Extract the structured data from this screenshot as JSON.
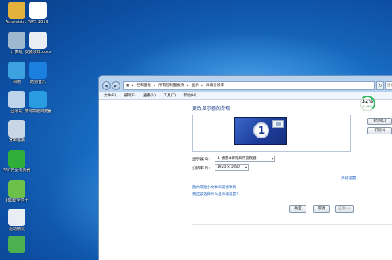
{
  "desktop": {
    "icons": [
      {
        "label": "Administr...",
        "icon": "user-folder-icon",
        "color": "#e3b23c"
      },
      {
        "label": "WPS 2019",
        "icon": "wps-icon",
        "color": "#ffffff"
      },
      {
        "label": "计算机",
        "icon": "computer-icon",
        "color": "#9fb8cf"
      },
      {
        "label": "安装须知.docx",
        "icon": "docx-icon",
        "color": "#e9eef5"
      },
      {
        "label": "网络",
        "icon": "network-icon",
        "color": "#3da3e0"
      },
      {
        "label": "酷狗音乐",
        "icon": "kugou-icon",
        "color": "#1b7fe0"
      },
      {
        "label": "回收站",
        "icon": "recycle-bin-icon",
        "color": "#bcd3ea"
      },
      {
        "label": "搜狗高速浏览器",
        "icon": "sogou-browser-icon",
        "color": "#2a9de0"
      },
      {
        "label": "宽带连接",
        "icon": "broadband-icon",
        "color": "#c9d6e6"
      },
      {
        "label": "360安全浏览器",
        "icon": "360-browser-icon",
        "color": "#2fae3a"
      },
      {
        "label": "360安全卫士",
        "icon": "360-guard-icon",
        "color": "#6cc04a"
      },
      {
        "label": "驱动精灵",
        "icon": "driver-icon",
        "color": "#e9eef5"
      },
      {
        "label": "",
        "icon": "shield-app-icon",
        "color": "#4caf50"
      }
    ]
  },
  "window": {
    "address": [
      "控制面板",
      "所有控制面板项",
      "显示",
      "屏幕分辨率"
    ],
    "search_placeholder": "搜索",
    "menu": [
      "文件(F)",
      "编辑(E)",
      "查看(V)",
      "工具(T)",
      "帮助(H)"
    ],
    "heading": "更改显示器的外观",
    "monitor_number": "1",
    "detect_button": "检测(C)",
    "identify_button": "识别(I)",
    "display_label": "显示器(S):",
    "display_value": "1. 通用非即插即用监视器",
    "resolution_label": "分辨率(R):",
    "resolution_value": "1920 × 1080",
    "advanced_link": "高级设置",
    "link_text_size": "放大或缩小文本和其他项目",
    "link_which": "我应该选择什么显示器设置?",
    "ok_button": "确定",
    "cancel_button": "取消",
    "apply_button": "应用(A)"
  },
  "gauge": {
    "percent": "32%",
    "speed": "↑ 0K/s"
  }
}
